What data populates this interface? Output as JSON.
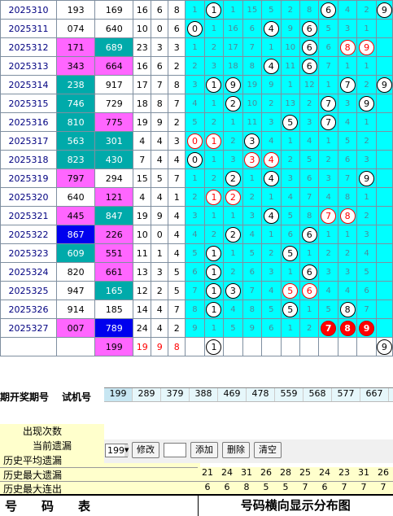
{
  "rows": [
    {
      "issue": "2025310",
      "open": "193",
      "ocol": "w",
      "test": "169",
      "tcol": "w",
      "sum": "16",
      "span": "6",
      "mod": "8",
      "cells": [
        [
          "1",
          "b"
        ],
        [
          "1",
          "c"
        ],
        [
          "1",
          "b"
        ],
        [
          "15",
          "b"
        ],
        [
          "5",
          "b"
        ],
        [
          "2",
          "b"
        ],
        [
          "8",
          "b"
        ],
        [
          "6",
          "c"
        ],
        [
          "4",
          "b"
        ],
        [
          "2",
          "b"
        ],
        [
          "9",
          "c"
        ]
      ]
    },
    {
      "issue": "2025311",
      "open": "074",
      "ocol": "w",
      "test": "640",
      "tcol": "w",
      "sum": "10",
      "span": "0",
      "mod": "6",
      "cells": [
        [
          "0",
          "c"
        ],
        [
          "1",
          "b"
        ],
        [
          "16",
          "b"
        ],
        [
          "6",
          "b"
        ],
        [
          "4",
          "c"
        ],
        [
          "9",
          "b"
        ],
        [
          "6",
          "c"
        ],
        [
          "5",
          "b"
        ],
        [
          "3",
          "b"
        ],
        [
          "1",
          "b"
        ]
      ]
    },
    {
      "issue": "2025312",
      "open": "171",
      "ocol": "p",
      "test": "689",
      "tcol": "t",
      "sum": "23",
      "span": "3",
      "mod": "3",
      "cells": [
        [
          "1",
          "b"
        ],
        [
          "2",
          "b"
        ],
        [
          "17",
          "b"
        ],
        [
          "7",
          "b"
        ],
        [
          "1",
          "b"
        ],
        [
          "10",
          "b"
        ],
        [
          "6",
          "c"
        ],
        [
          "6",
          "b"
        ],
        [
          "8",
          "r"
        ],
        [
          "9",
          "r"
        ]
      ]
    },
    {
      "issue": "2025313",
      "open": "343",
      "ocol": "p",
      "test": "664",
      "tcol": "p",
      "sum": "16",
      "span": "6",
      "mod": "2",
      "cells": [
        [
          "2",
          "b"
        ],
        [
          "3",
          "b"
        ],
        [
          "18",
          "b"
        ],
        [
          "8",
          "b"
        ],
        [
          "4",
          "c"
        ],
        [
          "11",
          "b"
        ],
        [
          "6",
          "c"
        ],
        [
          "7",
          "b"
        ],
        [
          "1",
          "b"
        ],
        [
          "1",
          "b"
        ]
      ]
    },
    {
      "issue": "2025314",
      "open": "238",
      "ocol": "t",
      "test": "917",
      "tcol": "w",
      "sum": "17",
      "span": "7",
      "mod": "8",
      "cells": [
        [
          "3",
          "b"
        ],
        [
          "1",
          "c"
        ],
        [
          "9",
          "c"
        ],
        [
          "19",
          "b"
        ],
        [
          "9",
          "b"
        ],
        [
          "1",
          "b"
        ],
        [
          "12",
          "b"
        ],
        [
          "1",
          "b"
        ],
        [
          "7",
          "c"
        ],
        [
          "2",
          "b"
        ],
        [
          "9",
          "c"
        ]
      ]
    },
    {
      "issue": "2025315",
      "open": "746",
      "ocol": "t",
      "test": "729",
      "tcol": "w",
      "sum": "18",
      "span": "8",
      "mod": "7",
      "cells": [
        [
          "4",
          "b"
        ],
        [
          "1",
          "b"
        ],
        [
          "2",
          "c"
        ],
        [
          "10",
          "b"
        ],
        [
          "2",
          "b"
        ],
        [
          "13",
          "b"
        ],
        [
          "2",
          "b"
        ],
        [
          "7",
          "c"
        ],
        [
          "3",
          "b"
        ],
        [
          "9",
          "c"
        ]
      ]
    },
    {
      "issue": "2025316",
      "open": "810",
      "ocol": "t",
      "test": "775",
      "tcol": "p",
      "sum": "19",
      "span": "9",
      "mod": "2",
      "cells": [
        [
          "5",
          "b"
        ],
        [
          "2",
          "b"
        ],
        [
          "1",
          "b"
        ],
        [
          "11",
          "b"
        ],
        [
          "3",
          "b"
        ],
        [
          "5",
          "c"
        ],
        [
          "3",
          "b"
        ],
        [
          "7",
          "c"
        ],
        [
          "4",
          "b"
        ],
        [
          "1",
          "b"
        ]
      ]
    },
    {
      "issue": "2025317",
      "open": "563",
      "ocol": "t",
      "test": "301",
      "tcol": "t",
      "sum": "4",
      "span": "4",
      "mod": "3",
      "cells": [
        [
          "0",
          "r"
        ],
        [
          "1",
          "r"
        ],
        [
          "2",
          "b"
        ],
        [
          "3",
          "c"
        ],
        [
          "4",
          "b"
        ],
        [
          "1",
          "b"
        ],
        [
          "4",
          "b"
        ],
        [
          "1",
          "b"
        ],
        [
          "5",
          "b"
        ],
        [
          "2",
          "b"
        ]
      ]
    },
    {
      "issue": "2025318",
      "open": "823",
      "ocol": "t",
      "test": "430",
      "tcol": "t",
      "sum": "7",
      "span": "4",
      "mod": "4",
      "cells": [
        [
          "0",
          "c"
        ],
        [
          "1",
          "b"
        ],
        [
          "3",
          "b"
        ],
        [
          "3",
          "r"
        ],
        [
          "4",
          "r"
        ],
        [
          "2",
          "b"
        ],
        [
          "5",
          "b"
        ],
        [
          "2",
          "b"
        ],
        [
          "6",
          "b"
        ],
        [
          "3",
          "b"
        ]
      ]
    },
    {
      "issue": "2025319",
      "open": "797",
      "ocol": "p",
      "test": "294",
      "tcol": "w",
      "sum": "15",
      "span": "5",
      "mod": "7",
      "cells": [
        [
          "1",
          "b"
        ],
        [
          "2",
          "b"
        ],
        [
          "2",
          "c"
        ],
        [
          "1",
          "b"
        ],
        [
          "4",
          "c"
        ],
        [
          "3",
          "b"
        ],
        [
          "6",
          "b"
        ],
        [
          "3",
          "b"
        ],
        [
          "7",
          "b"
        ],
        [
          "9",
          "c"
        ]
      ]
    },
    {
      "issue": "2025320",
      "open": "640",
      "ocol": "w",
      "test": "121",
      "tcol": "p",
      "sum": "4",
      "span": "4",
      "mod": "1",
      "cells": [
        [
          "2",
          "b"
        ],
        [
          "1",
          "r"
        ],
        [
          "2",
          "r"
        ],
        [
          "2",
          "b"
        ],
        [
          "1",
          "b"
        ],
        [
          "4",
          "b"
        ],
        [
          "7",
          "b"
        ],
        [
          "4",
          "b"
        ],
        [
          "8",
          "b"
        ],
        [
          "1",
          "b"
        ]
      ]
    },
    {
      "issue": "2025321",
      "open": "445",
      "ocol": "p",
      "test": "847",
      "tcol": "t",
      "sum": "19",
      "span": "9",
      "mod": "4",
      "cells": [
        [
          "3",
          "b"
        ],
        [
          "1",
          "b"
        ],
        [
          "1",
          "b"
        ],
        [
          "3",
          "b"
        ],
        [
          "4",
          "c"
        ],
        [
          "5",
          "b"
        ],
        [
          "8",
          "b"
        ],
        [
          "7",
          "r"
        ],
        [
          "8",
          "r"
        ],
        [
          "2",
          "b"
        ]
      ]
    },
    {
      "issue": "2025322",
      "open": "867",
      "ocol": "b",
      "test": "226",
      "tcol": "p",
      "sum": "10",
      "span": "0",
      "mod": "4",
      "cells": [
        [
          "4",
          "b"
        ],
        [
          "2",
          "b"
        ],
        [
          "2",
          "c"
        ],
        [
          "4",
          "b"
        ],
        [
          "1",
          "b"
        ],
        [
          "6",
          "b"
        ],
        [
          "6",
          "c"
        ],
        [
          "1",
          "b"
        ],
        [
          "1",
          "b"
        ],
        [
          "3",
          "b"
        ]
      ]
    },
    {
      "issue": "2025323",
      "open": "609",
      "ocol": "t",
      "test": "551",
      "tcol": "p",
      "sum": "11",
      "span": "1",
      "mod": "4",
      "cells": [
        [
          "5",
          "b"
        ],
        [
          "1",
          "c"
        ],
        [
          "1",
          "b"
        ],
        [
          "5",
          "b"
        ],
        [
          "2",
          "b"
        ],
        [
          "5",
          "c"
        ],
        [
          "1",
          "b"
        ],
        [
          "2",
          "b"
        ],
        [
          "2",
          "b"
        ],
        [
          "4",
          "b"
        ]
      ]
    },
    {
      "issue": "2025324",
      "open": "820",
      "ocol": "w",
      "test": "661",
      "tcol": "p",
      "sum": "13",
      "span": "3",
      "mod": "5",
      "cells": [
        [
          "6",
          "b"
        ],
        [
          "1",
          "c"
        ],
        [
          "2",
          "b"
        ],
        [
          "6",
          "b"
        ],
        [
          "3",
          "b"
        ],
        [
          "1",
          "b"
        ],
        [
          "6",
          "c"
        ],
        [
          "3",
          "b"
        ],
        [
          "3",
          "b"
        ],
        [
          "5",
          "b"
        ]
      ]
    },
    {
      "issue": "2025325",
      "open": "947",
      "ocol": "w",
      "test": "165",
      "tcol": "t",
      "sum": "12",
      "span": "2",
      "mod": "5",
      "cells": [
        [
          "7",
          "b"
        ],
        [
          "1",
          "c"
        ],
        [
          "3",
          "c"
        ],
        [
          "7",
          "b"
        ],
        [
          "4",
          "b"
        ],
        [
          "5",
          "r"
        ],
        [
          "6",
          "r"
        ],
        [
          "4",
          "b"
        ],
        [
          "4",
          "b"
        ],
        [
          "6",
          "b"
        ]
      ]
    },
    {
      "issue": "2025326",
      "open": "914",
      "ocol": "w",
      "test": "185",
      "tcol": "w",
      "sum": "14",
      "span": "4",
      "mod": "7",
      "cells": [
        [
          "8",
          "b"
        ],
        [
          "1",
          "c"
        ],
        [
          "4",
          "b"
        ],
        [
          "8",
          "b"
        ],
        [
          "5",
          "b"
        ],
        [
          "5",
          "c"
        ],
        [
          "1",
          "b"
        ],
        [
          "5",
          "b"
        ],
        [
          "8",
          "c"
        ],
        [
          "7",
          "b"
        ]
      ]
    },
    {
      "issue": "2025327",
      "open": "007",
      "ocol": "p",
      "test": "789",
      "tcol": "b",
      "sum": "24",
      "span": "4",
      "mod": "2",
      "cells": [
        [
          "9",
          "b"
        ],
        [
          "1",
          "b"
        ],
        [
          "5",
          "b"
        ],
        [
          "9",
          "b"
        ],
        [
          "6",
          "b"
        ],
        [
          "1",
          "b"
        ],
        [
          "2",
          "b"
        ],
        [
          "7",
          "f"
        ],
        [
          "8",
          "f"
        ],
        [
          "9",
          "f"
        ]
      ]
    }
  ],
  "footer_row": {
    "test": "199",
    "sum": "19",
    "span": "9",
    "mod": "8",
    "circles": [
      "1",
      "9"
    ]
  },
  "panel": {
    "tags": [
      "199",
      "289",
      "379",
      "388",
      "469",
      "478",
      "559",
      "568",
      "577",
      "667"
    ],
    "select_value": "199",
    "buttons": {
      "modify": "修改",
      "add": "添加",
      "delete": "删除",
      "clear": "清空"
    }
  },
  "labels": {
    "header_open": "开奖期号",
    "header_test": "试机号",
    "header_prefix": "期",
    "occurrences": "出现次数",
    "current_miss": "当前遗漏",
    "avg_miss": "历史平均遗漏",
    "max_miss": "历史最大遗漏",
    "max_streak": "历史最大连出"
  },
  "stats": {
    "max_miss": [
      "21",
      "24",
      "31",
      "26",
      "28",
      "25",
      "24",
      "23",
      "31",
      "26"
    ],
    "max_streak": [
      "6",
      "6",
      "8",
      "5",
      "5",
      "7",
      "6",
      "7",
      "7",
      "7"
    ]
  },
  "footer": {
    "left": "号码表",
    "right": "号码横向显示分布图"
  },
  "colors": {
    "cyan": "#00ffff",
    "pink": "#ff66ff",
    "teal": "#00aaaa",
    "blue": "#0000ee",
    "red": "#ff0000"
  }
}
